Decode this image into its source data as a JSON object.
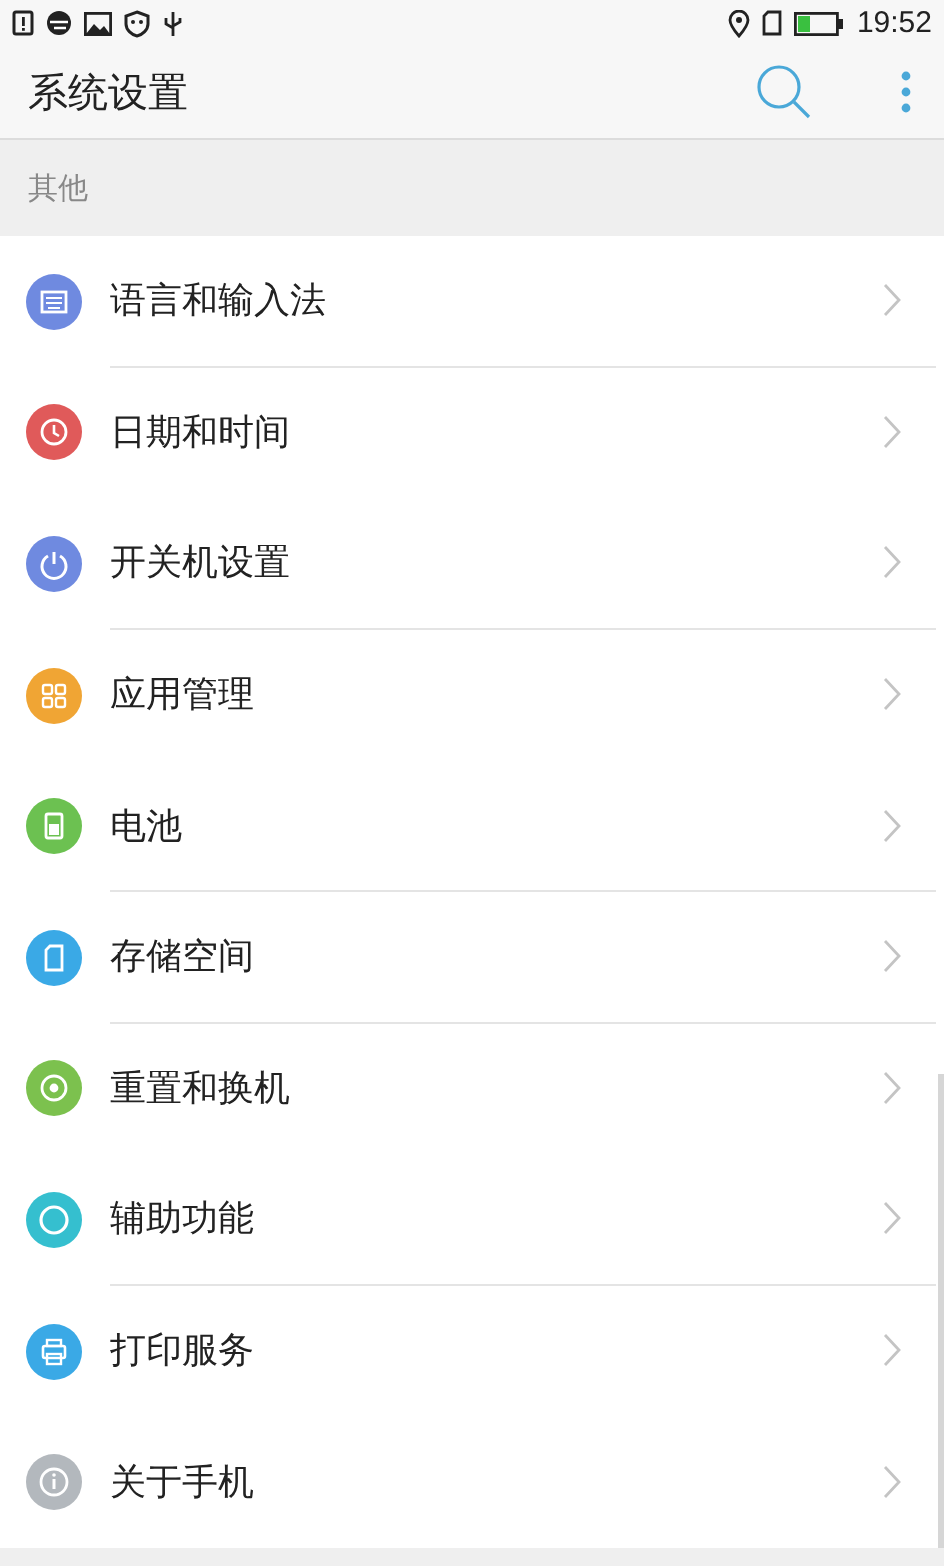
{
  "status_bar": {
    "time": "19:52"
  },
  "app_bar": {
    "title": "系统设置"
  },
  "section": {
    "title": "其他"
  },
  "items": [
    {
      "label": "语言和输入法",
      "kind": "keyboard",
      "color": "#6f8ae0"
    },
    {
      "label": "日期和时间",
      "kind": "clock",
      "color": "#e05a5a"
    },
    {
      "label": "开关机设置",
      "kind": "power",
      "color": "#6f8ae0"
    },
    {
      "label": "应用管理",
      "kind": "apps",
      "color": "#f0a534"
    },
    {
      "label": "电池",
      "kind": "battery",
      "color": "#6cc151"
    },
    {
      "label": "存储空间",
      "kind": "sdcard",
      "color": "#3aa9e6"
    },
    {
      "label": "重置和换机",
      "kind": "reset",
      "color": "#7cc14e"
    },
    {
      "label": "辅助功能",
      "kind": "ring",
      "color": "#35bfcf"
    },
    {
      "label": "打印服务",
      "kind": "printer",
      "color": "#3aa9e6"
    },
    {
      "label": "关于手机",
      "kind": "info",
      "color": "#b3b8bd"
    }
  ]
}
